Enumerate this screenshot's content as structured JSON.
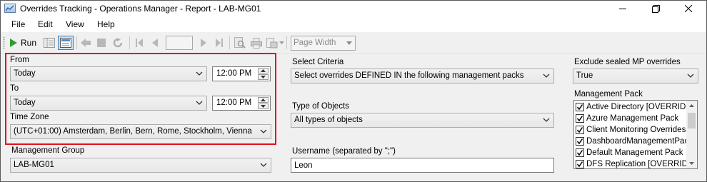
{
  "window": {
    "title": "Overrides Tracking - Operations Manager - Report - LAB-MG01"
  },
  "menu": {
    "file": "File",
    "edit": "Edit",
    "view": "View",
    "help": "Help"
  },
  "toolbar": {
    "run_label": "Run",
    "zoom_value": "Page Width"
  },
  "params": {
    "from_label": "From",
    "from_date": "Today",
    "from_time": "12:00 PM",
    "to_label": "To",
    "to_date": "Today",
    "to_time": "12:00 PM",
    "timezone_label": "Time Zone",
    "timezone_value": "(UTC+01:00) Amsterdam, Berlin, Bern, Rome, Stockholm, Vienna",
    "mgmt_group_label": "Management Group",
    "mgmt_group_value": "LAB-MG01",
    "criteria_label": "Select Criteria",
    "criteria_value": "Select overrides DEFINED IN the following management packs",
    "objects_label": "Type of Objects",
    "objects_value": "All types of objects",
    "username_label": "Username (separated by \";\")",
    "username_value": "Leon",
    "sealed_label": "Exclude sealed MP overrides",
    "sealed_value": "True",
    "mp_label": "Management Pack",
    "mp_items": [
      "Active Directory [OVERRIDES]",
      "Azure Management Pack",
      "Client Monitoring Overrides MP",
      "DashboardManagementPack",
      "Default Management Pack",
      "DFS Replication [OVERRIDES]"
    ]
  },
  "colors": {
    "highlight": "#e0111b",
    "run_green": "#2e9e2e"
  }
}
